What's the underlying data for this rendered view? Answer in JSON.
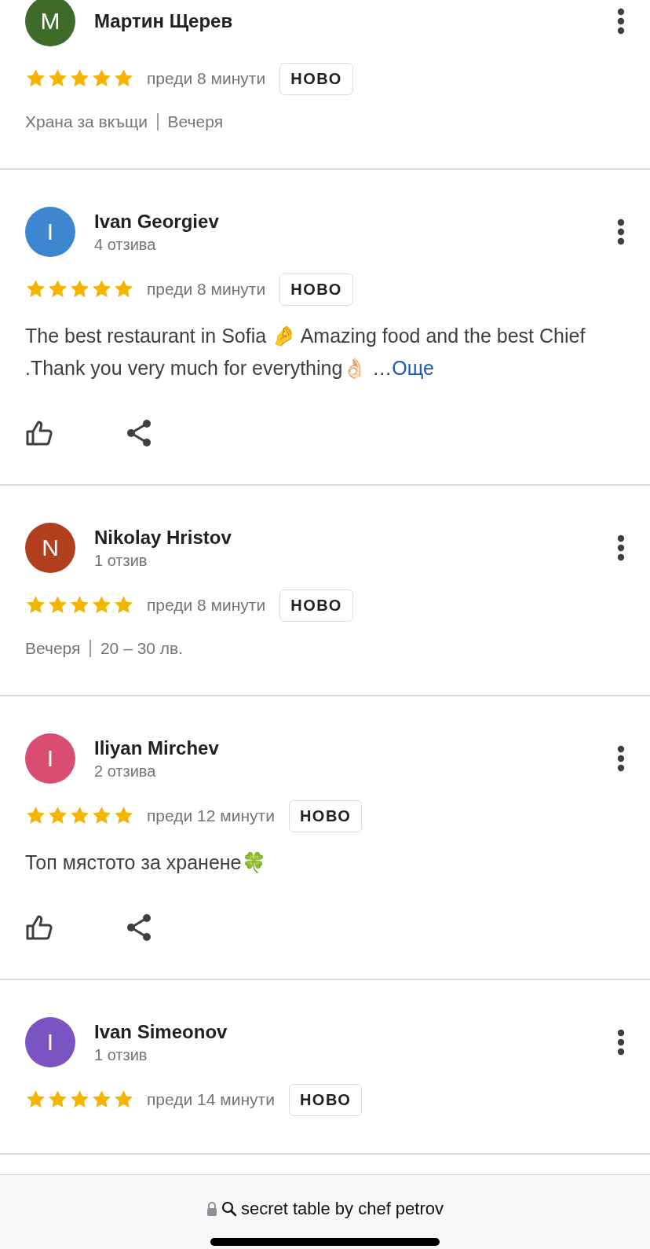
{
  "reviews": [
    {
      "initial": "M",
      "color": "#3f6b2a",
      "name": "Мартин Щерев",
      "stars": 5,
      "time": "преди 8 минути",
      "badge": "НОВО",
      "tags": [
        "Храна за вкъщи",
        "Вечеря"
      ]
    },
    {
      "initial": "I",
      "color": "#3d86d0",
      "name": "Ivan Georgiev",
      "count": "4 отзива",
      "stars": 5,
      "time": "преди 8 минути",
      "badge": "НОВО",
      "text": "The best restaurant in Sofia 🤌 Amazing food and the best Chief .Thank you very much for everything👌🏻 …",
      "more": "Още",
      "actions": true
    },
    {
      "initial": "N",
      "color": "#b2401e",
      "name": "Nikolay Hristov",
      "count": "1 отзив",
      "stars": 5,
      "time": "преди 8 минути",
      "badge": "НОВО",
      "tags": [
        "Вечеря",
        "20 – 30 лв."
      ]
    },
    {
      "initial": "I",
      "color": "#d94d73",
      "name": "Iliyan Mirchev",
      "count": "2 отзива",
      "stars": 5,
      "time": "преди 12 минути",
      "badge": "НОВО",
      "text": "Топ мястото за хранене🍀",
      "actions": true
    },
    {
      "initial": "I",
      "color": "#7a55c2",
      "name": "Ivan Simeonov",
      "count": "1 отзив",
      "stars": 5,
      "time": "преди 14 минути",
      "badge": "НОВО"
    }
  ],
  "address_bar": {
    "url": "secret table by chef petrov"
  }
}
